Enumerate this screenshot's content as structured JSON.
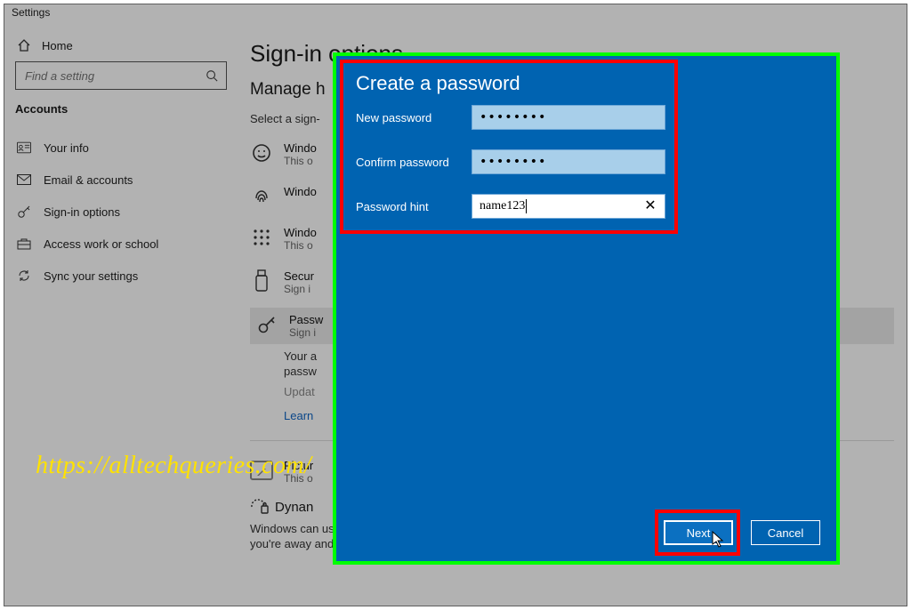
{
  "window": {
    "title": "Settings"
  },
  "sidebar": {
    "home": "Home",
    "search_placeholder": "Find a setting",
    "section": "Accounts",
    "items": [
      {
        "label": "Your info"
      },
      {
        "label": "Email & accounts"
      },
      {
        "label": "Sign-in options"
      },
      {
        "label": "Access work or school"
      },
      {
        "label": "Sync your settings"
      }
    ]
  },
  "main": {
    "title": "Sign-in options",
    "subtitle_truncated": "Manage h",
    "select_line_truncated": "Select a sign-",
    "options": [
      {
        "title_truncated": "Windo",
        "sub_truncated": "This o"
      },
      {
        "title_truncated": "Windo",
        "sub_truncated": ""
      },
      {
        "title_truncated": "Windo",
        "sub_truncated": "This o"
      },
      {
        "title_truncated": "Secur",
        "sub_truncated": "Sign i"
      },
      {
        "title_truncated": "Passw",
        "sub_truncated": "Sign i"
      }
    ],
    "pw_block": {
      "line1_truncated": "Your a",
      "line2_truncated": "passw",
      "update_truncated": "Updat",
      "learn_truncated": "Learn"
    },
    "picture": {
      "title_truncated": "Pictur",
      "sub_truncated": "This o"
    },
    "dynamic_truncated": "Dynan",
    "dynamic_desc1": "Windows can use devices that are paired to your PC to know when",
    "dynamic_desc2": "you're away and lock your PC when those devices go out of range."
  },
  "dialog": {
    "title": "Create a password",
    "labels": {
      "new": "New password",
      "confirm": "Confirm password",
      "hint": "Password hint"
    },
    "values": {
      "new_masked": "••••••••",
      "confirm_masked": "••••••••",
      "hint": "name123"
    },
    "buttons": {
      "next": "Next",
      "cancel": "Cancel"
    }
  },
  "watermark": "https://alltechqueries.com/"
}
